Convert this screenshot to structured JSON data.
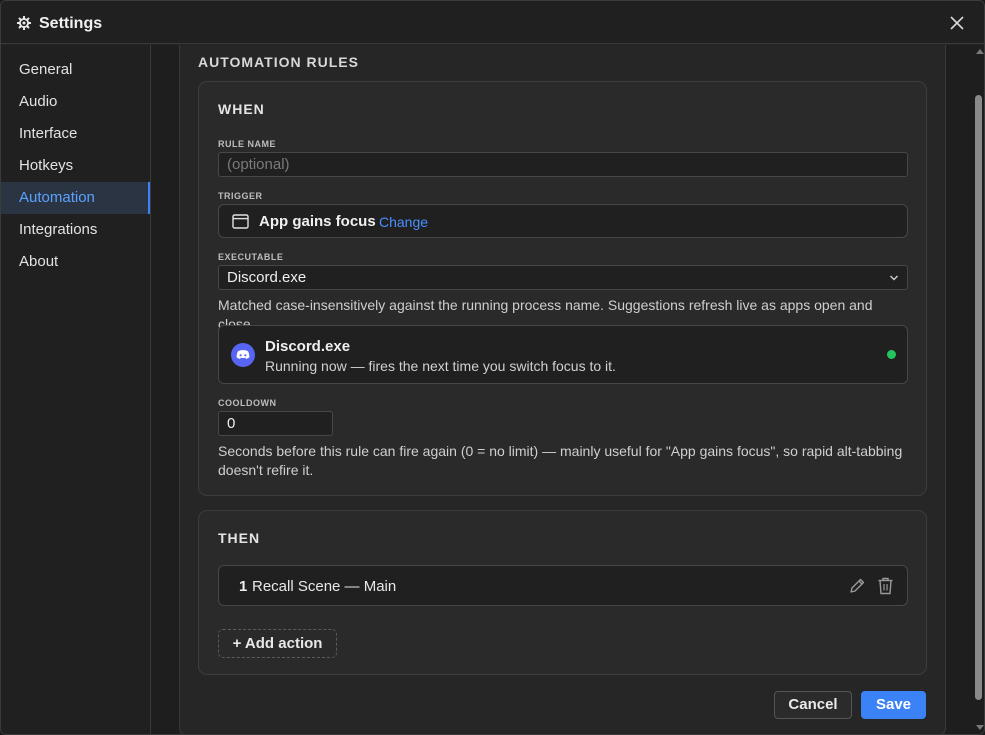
{
  "window": {
    "title": "Settings",
    "icon": "gear-icon",
    "close_icon": "close-icon"
  },
  "sidebar": {
    "items": [
      {
        "label": "General",
        "active": false
      },
      {
        "label": "Audio",
        "active": false
      },
      {
        "label": "Interface",
        "active": false
      },
      {
        "label": "Hotkeys",
        "active": false
      },
      {
        "label": "Automation",
        "active": true
      },
      {
        "label": "Integrations",
        "active": false
      },
      {
        "label": "About",
        "active": false
      }
    ]
  },
  "main": {
    "section_title": "AUTOMATION RULES",
    "when": {
      "title": "WHEN",
      "rule_name": {
        "label": "RULE NAME",
        "value": "",
        "placeholder": "(optional)"
      },
      "trigger": {
        "label": "TRIGGER",
        "value": "App gains focus",
        "change_label": "Change",
        "icon": "window-icon"
      },
      "executable": {
        "label": "EXECUTABLE",
        "value": "Discord.exe",
        "help": "Matched case-insensitively against the running process name. Suggestions refresh live as apps open and close."
      },
      "app_status": {
        "name": "Discord.exe",
        "status": "Running now — fires the next time you switch focus to it.",
        "icon": "discord-icon",
        "status_color": "#22c55e"
      },
      "cooldown": {
        "label": "COOLDOWN",
        "value": "0",
        "help": "Seconds before this rule can fire again (0 = no limit) — mainly useful for \"App gains focus\", so rapid alt-tabbing doesn't refire it."
      }
    },
    "then": {
      "title": "THEN",
      "actions": [
        {
          "index": "1",
          "label": "Recall Scene — Main"
        }
      ],
      "add_action_label": "+ Add action"
    },
    "footer": {
      "cancel_label": "Cancel",
      "save_label": "Save"
    }
  },
  "colors": {
    "accent": "#3b82f6",
    "link": "#4a90ff",
    "discord": "#5865f2",
    "online": "#22c55e"
  }
}
